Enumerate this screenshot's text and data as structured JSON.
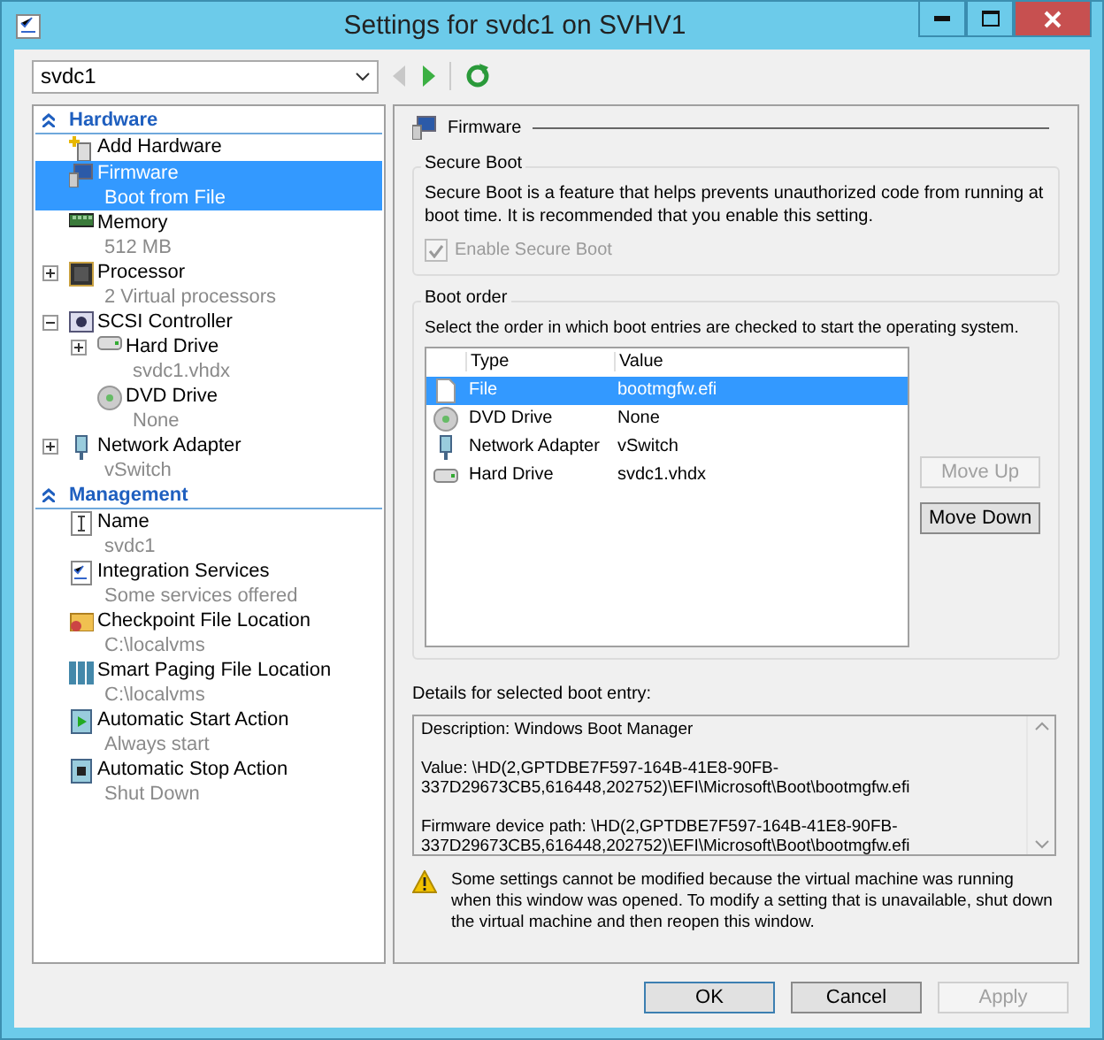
{
  "window": {
    "title": "Settings for svdc1 on SVHV1"
  },
  "vm_select": {
    "value": "svdc1"
  },
  "nav": {
    "back": {
      "disabled": true
    },
    "forward": {
      "disabled": false
    }
  },
  "tree": [
    {
      "label": "Hardware",
      "expanded": true,
      "items": [
        {
          "kind": "add-hardware",
          "label": "Add Hardware",
          "selected": false
        },
        {
          "kind": "firmware",
          "label": "Firmware",
          "detail": "Boot from File",
          "selected": true
        },
        {
          "kind": "memory",
          "label": "Memory",
          "detail": "512 MB",
          "selected": false
        },
        {
          "kind": "processor",
          "label": "Processor",
          "detail": "2 Virtual processors",
          "selected": false,
          "expanded": false
        },
        {
          "kind": "scsi",
          "label": "SCSI Controller",
          "selected": false,
          "expanded": true,
          "children": [
            {
              "kind": "hard-drive",
              "label": "Hard Drive",
              "detail": "svdc1.vhdx",
              "selected": false,
              "expanded": false
            },
            {
              "kind": "dvd",
              "label": "DVD Drive",
              "detail": "None",
              "selected": false
            }
          ]
        },
        {
          "kind": "network",
          "label": "Network Adapter",
          "detail": "vSwitch",
          "selected": false,
          "expanded": false
        }
      ]
    },
    {
      "label": "Management",
      "expanded": true,
      "items": [
        {
          "kind": "name",
          "label": "Name",
          "detail": "svdc1",
          "selected": false
        },
        {
          "kind": "integration",
          "label": "Integration Services",
          "detail": "Some services offered",
          "selected": false
        },
        {
          "kind": "checkpoint",
          "label": "Checkpoint File Location",
          "detail": "C:\\localvms",
          "selected": false
        },
        {
          "kind": "paging",
          "label": "Smart Paging File Location",
          "detail": "C:\\localvms",
          "selected": false
        },
        {
          "kind": "start",
          "label": "Automatic Start Action",
          "detail": "Always start",
          "selected": false
        },
        {
          "kind": "stop",
          "label": "Automatic Stop Action",
          "detail": "Shut Down",
          "selected": false
        }
      ]
    }
  ],
  "panel": {
    "title": "Firmware",
    "secure_boot": {
      "title": "Secure Boot",
      "text": "Secure Boot is a feature that helps prevents unauthorized code from running at boot time. It is recommended that you enable this setting.",
      "checkbox": {
        "label": "Enable Secure Boot",
        "checked": true,
        "disabled": true
      }
    },
    "boot_order": {
      "title": "Boot order",
      "instruction": "Select the order in which boot entries are checked to start the operating system.",
      "columns": [
        "Type",
        "Value"
      ],
      "rows": [
        {
          "kind": "file",
          "type": "File",
          "value": "bootmgfw.efi",
          "selected": true
        },
        {
          "kind": "dvd",
          "type": "DVD Drive",
          "value": "None",
          "selected": false
        },
        {
          "kind": "network",
          "type": "Network Adapter",
          "value": "vSwitch",
          "selected": false
        },
        {
          "kind": "hard-drive",
          "type": "Hard Drive",
          "value": "svdc1.vhdx",
          "selected": false
        }
      ],
      "buttons": [
        {
          "label": "Move Up",
          "disabled": true
        },
        {
          "label": "Move Down",
          "disabled": false
        }
      ]
    },
    "details": {
      "label": "Details for selected boot entry:",
      "paragraphs": [
        "Description: Windows Boot Manager",
        "Value: \\HD(2,GPTDBE7F597-164B-41E8-90FB-337D29673CB5,616448,202752)\\EFI\\Microsoft\\Boot\\bootmgfw.efi",
        "Firmware device path: \\HD(2,GPTDBE7F597-164B-41E8-90FB-337D29673CB5,616448,202752)\\EFI\\Microsoft\\Boot\\bootmgfw.efi"
      ]
    },
    "warning": "Some settings cannot be modified because the virtual machine was running when this window was opened. To modify a setting that is unavailable, shut down the virtual machine and then reopen this window."
  },
  "buttons": [
    {
      "label": "OK",
      "disabled": false,
      "default": true
    },
    {
      "label": "Cancel",
      "disabled": false,
      "default": false
    },
    {
      "label": "Apply",
      "disabled": true,
      "default": false
    }
  ]
}
